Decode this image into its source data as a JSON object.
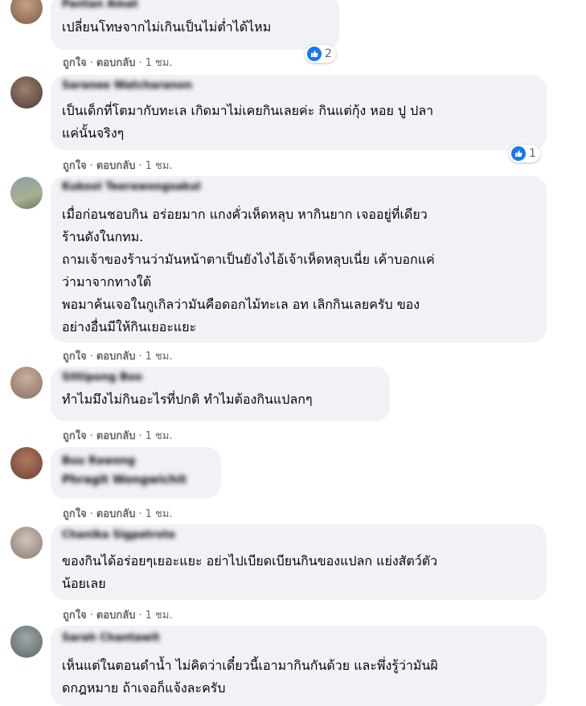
{
  "actions": {
    "like": "ถูกใจ",
    "reply": "ตอบกลับ",
    "sep": "·",
    "time": "1 ชม."
  },
  "comments": [
    {
      "name": "Pantan Amat",
      "lines": [
        "เปลี่ยนโทษจากไม่เกินเป็นไม่ต่ำได้ไหม"
      ],
      "reactions": "2"
    },
    {
      "name": "Saranee Watcharanon",
      "lines": [
        "เป็นเด็กที่โตมากับทะเล เกิดมาไม่เคยกินเลยค่ะ กินแต่กุ้ง หอย ปู ปลา",
        "แค่นั้นจริงๆ"
      ],
      "reactions": "1"
    },
    {
      "name": "Kukool Teerawongsakul",
      "lines": [
        "เมื่อก่อนชอบกิน อร่อยมาก แกงคั่วเห็ดหลุบ หากินยาก เจออยู่ที่เดียว",
        "ร้านดังในกทม.",
        "ถามเจ้าของร้านว่ามันหน้าตาเป็นยังไงไอ้เจ้าเห็ดหลุบเนี่ย เค้าบอกแค่",
        "ว่ามาจากทางใต้",
        "พอมาค้นเจอในกูเกิลว่ามันคือดอกไม้ทะเล อท เลิกกินเลยครับ ของ",
        "อย่างอื่นมีให้กินเยอะแยะ"
      ]
    },
    {
      "name": "Sittipong Boo",
      "lines": [
        "ทำไมมึงไม่กินอะไรที่ปกติ ทำไมต้องกินแปลกๆ"
      ]
    },
    {
      "name": "Buu Rawong",
      "lines": [
        "Phragit Wongwichit"
      ]
    },
    {
      "name": "Chanika Sigpatrote",
      "lines": [
        "ของกินได้อร่อยๆเยอะแยะ อย่าไปเบียดเบียนกินของแปลก แย่งสัตว์ตัว",
        "น้อยเลย"
      ]
    },
    {
      "name": "Sarah Chantawit",
      "lines": [
        "เห็นแต่ในตอนดำน้ำ ไม่คิดว่าเดี๋ยวนี้เอามากินกันด้วย และพึ่งรู้ว่ามันผิ",
        "ดกฎหมาย ถ้าเจอก็แจ้งละครับ"
      ]
    }
  ],
  "colors": {
    "bubble": "#f0f2f5",
    "like": "#1877f2",
    "meta": "#65676b"
  }
}
